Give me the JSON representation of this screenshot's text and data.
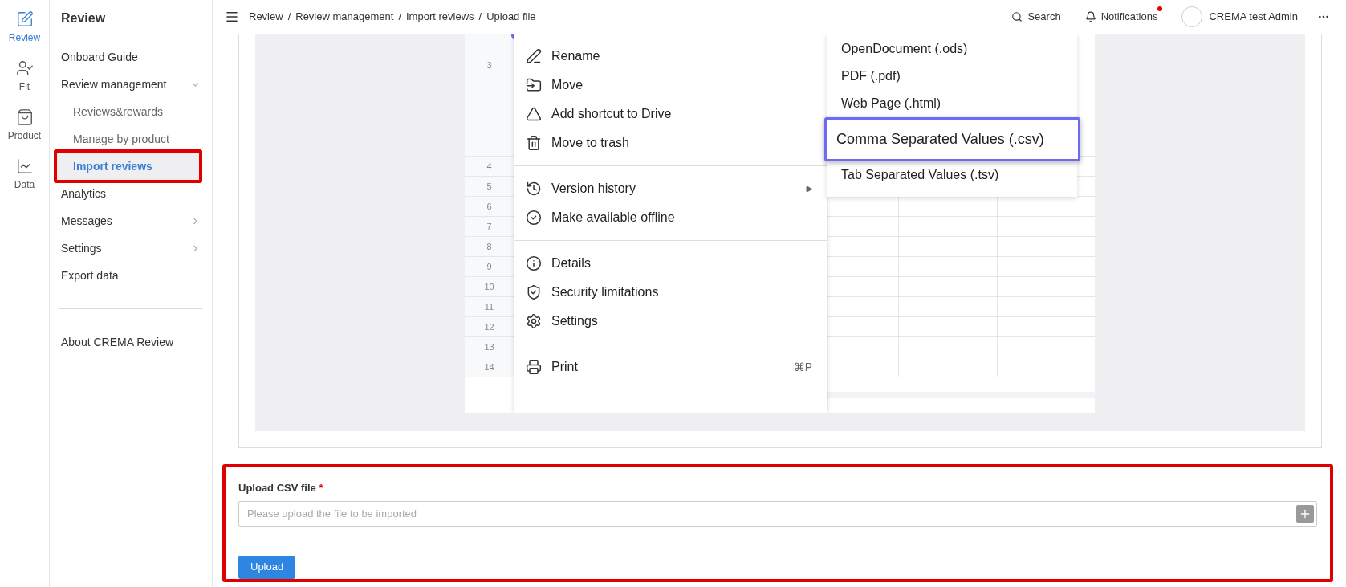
{
  "rail": [
    {
      "label": "Review",
      "selected": true
    },
    {
      "label": "Fit",
      "selected": false
    },
    {
      "label": "Product",
      "selected": false
    },
    {
      "label": "Data",
      "selected": false
    }
  ],
  "sidebar": {
    "title": "Review",
    "items": [
      {
        "label": "Onboard Guide",
        "selected": false
      },
      {
        "label": "Review management",
        "selected": false,
        "expandable": true,
        "expanded": true,
        "children": [
          {
            "label": "Reviews&rewards",
            "selected": false,
            "annotated": false
          },
          {
            "label": "Manage by product",
            "selected": false,
            "annotated": false
          },
          {
            "label": "Import reviews",
            "selected": true,
            "annotated": true
          }
        ]
      },
      {
        "label": "Analytics",
        "selected": false
      },
      {
        "label": "Messages",
        "selected": false,
        "expandable": true,
        "expanded": false
      },
      {
        "label": "Settings",
        "selected": false,
        "expandable": true,
        "expanded": false
      },
      {
        "label": "Export data",
        "selected": false
      }
    ],
    "footer_items": [
      {
        "label": "About CREMA Review"
      }
    ]
  },
  "header": {
    "breadcrumb": [
      "Review",
      "Review management",
      "Import reviews",
      "Upload file"
    ],
    "separator": "/",
    "search": "Search",
    "notifications": {
      "label": "Notifications",
      "unread": true
    },
    "user": "CREMA test Admin"
  },
  "embedded_screenshot": {
    "row_numbers": [
      "3",
      "4",
      "5",
      "6",
      "7",
      "8",
      "9",
      "10",
      "11",
      "12",
      "13",
      "14"
    ],
    "menu_groups": [
      [
        {
          "label": "Rename"
        },
        {
          "label": "Move"
        },
        {
          "label": "Add shortcut to Drive"
        },
        {
          "label": "Move to trash"
        }
      ],
      [
        {
          "label": "Version history",
          "submenu": true
        },
        {
          "label": "Make available offline",
          "submenu": false
        }
      ],
      [
        {
          "label": "Details"
        },
        {
          "label": "Security limitations"
        },
        {
          "label": "Settings"
        }
      ],
      [
        {
          "label": "Print",
          "shortcut": "⌘P"
        }
      ]
    ],
    "submenu": [
      {
        "label": "OpenDocument (.ods)",
        "highlighted": false
      },
      {
        "label": "PDF (.pdf)",
        "highlighted": false
      },
      {
        "label": "Web Page (.html)",
        "highlighted": false
      },
      {
        "label": "Comma Separated Values (.csv)",
        "highlighted": true
      },
      {
        "label": "Tab Separated Values (.tsv)",
        "highlighted": false
      }
    ]
  },
  "form": {
    "annotated": true,
    "label": "Upload CSV file",
    "required": true,
    "required_mark": "*",
    "placeholder": "Please upload the file to be imported",
    "button": "Upload"
  }
}
